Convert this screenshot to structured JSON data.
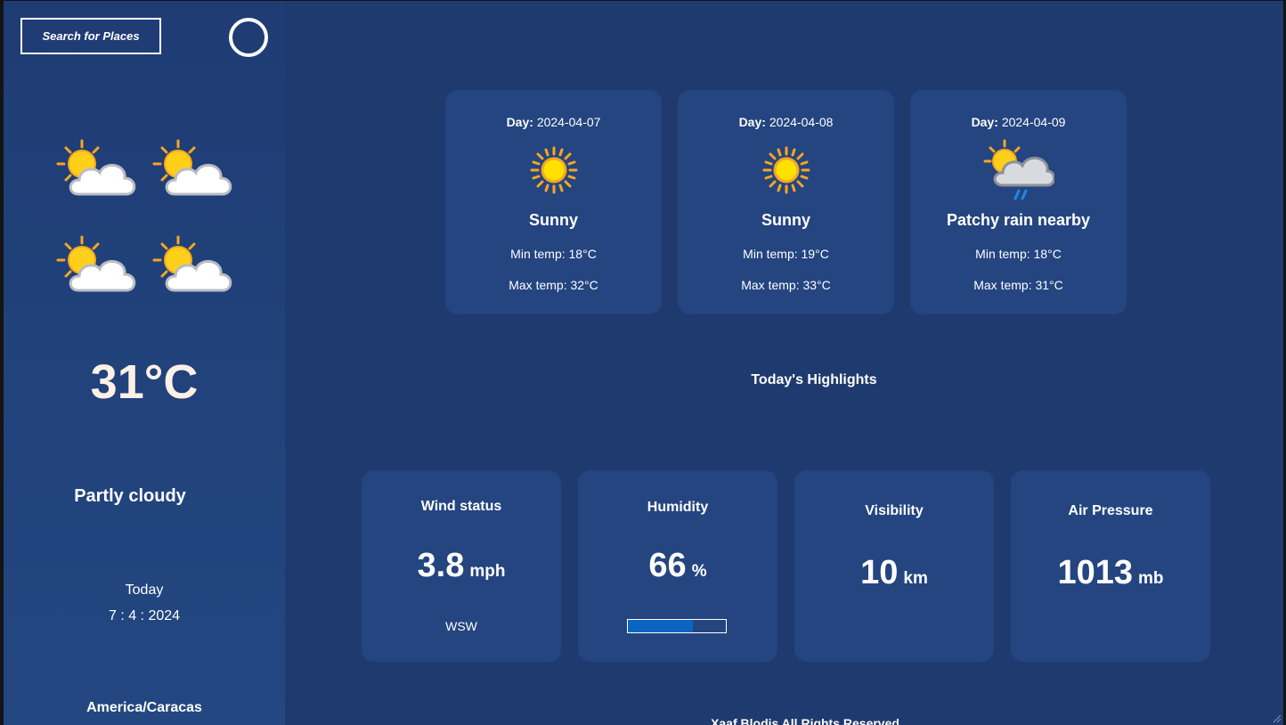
{
  "search": {
    "label": "Search for Places"
  },
  "current": {
    "temperature": "31°C",
    "condition": "Partly cloudy",
    "today_label": "Today",
    "date": "7 : 4 : 2024",
    "timezone": "America/Caracas",
    "icon": "partly-cloudy-icon"
  },
  "forecast": [
    {
      "day_label": "Day:",
      "date": "2024-04-07",
      "condition": "Sunny",
      "min": "Min temp: 18°C",
      "max": "Max temp: 32°C",
      "icon": "sun-icon"
    },
    {
      "day_label": "Day:",
      "date": "2024-04-08",
      "condition": "Sunny",
      "min": "Min temp: 19°C",
      "max": "Max temp: 33°C",
      "icon": "sun-icon"
    },
    {
      "day_label": "Day:",
      "date": "2024-04-09",
      "condition": "Patchy rain nearby",
      "min": "Min temp: 18°C",
      "max": "Max temp: 31°C",
      "icon": "patchy-rain-icon"
    }
  ],
  "highlights": {
    "title": "Today's Highlights",
    "wind": {
      "title": "Wind status",
      "value": "3.8",
      "unit": "mph",
      "direction": "WSW"
    },
    "humidity": {
      "title": "Humidity",
      "value": "66",
      "unit": "%",
      "percent": 66
    },
    "visibility": {
      "title": "Visibility",
      "value": "10",
      "unit": "km"
    },
    "pressure": {
      "title": "Air Pressure",
      "value": "1013",
      "unit": "mb"
    }
  },
  "footer": {
    "text": "Xaaf Blodis All Rights Reserved"
  },
  "colors": {
    "background": "#1f3a6e",
    "card": "#244580",
    "humidity_fill": "#0b66c3",
    "sun": "#ffc107"
  }
}
